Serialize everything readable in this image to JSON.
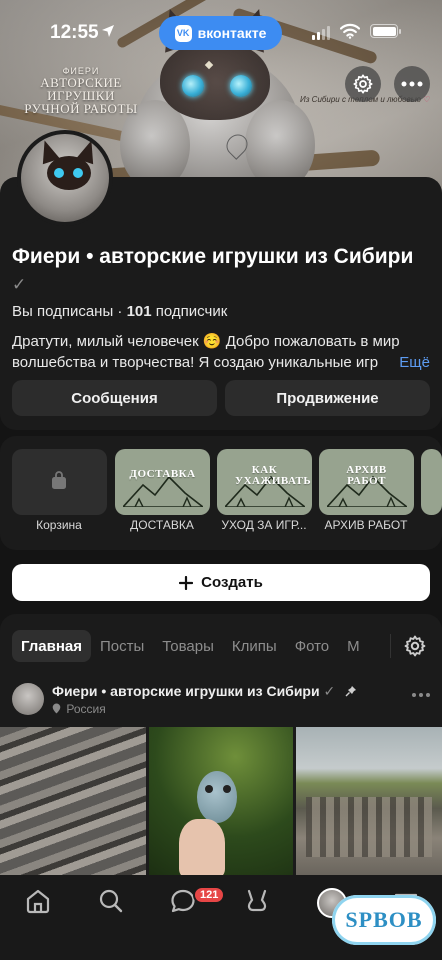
{
  "status_bar": {
    "time": "12:55",
    "app_pill": "вконтакте",
    "app_pill_logo": "VK"
  },
  "cover": {
    "brand_small": "ФИЕРИ",
    "brand_line1": "АВТОРСКИЕ ИГРУШКИ",
    "brand_line2": "РУЧНОЙ РАБОТЫ",
    "tagline": "Из Сибири с теплом и любовью"
  },
  "profile": {
    "name": "Фиери • авторские игрушки из Сибири",
    "verified_mark": "✓",
    "subscription_status": "Вы подписаны",
    "separator": "·",
    "subscriber_count": "101",
    "subscriber_label": "подписчик",
    "description": "Дратути, милый человечек ☺️ Добро пожаловать в мир волшебства и творчества! Я создаю уникальные игр",
    "more_link": "Ещё",
    "buttons": {
      "messages": "Сообщения",
      "promotion": "Продвижение"
    }
  },
  "showcase": {
    "items": [
      {
        "label": "Корзина",
        "cover_text": "",
        "icon": "shopping-bag-icon"
      },
      {
        "label": "ДОСТАВКА",
        "cover_text": "ДОСТАВКА"
      },
      {
        "label": "УХОД ЗА ИГР...",
        "cover_text": "КАК УХАЖИВАТЬ"
      },
      {
        "label": "АРХИВ РАБОТ",
        "cover_text": "АРХИВ РАБОТ"
      }
    ]
  },
  "create_button": {
    "icon": "plus-icon",
    "label": "Создать"
  },
  "tabs": [
    {
      "label": "Главная",
      "active": true
    },
    {
      "label": "Посты",
      "active": false
    },
    {
      "label": "Товары",
      "active": false
    },
    {
      "label": "Клипы",
      "active": false
    },
    {
      "label": "Фото",
      "active": false
    },
    {
      "label": "М",
      "active": false
    }
  ],
  "post": {
    "author": "Фиери • авторские игрушки из Сибири",
    "verified_mark": "✓",
    "location": "Россия",
    "pinned": true
  },
  "bottom_nav": {
    "items": [
      "home-icon",
      "search-icon",
      "messages-icon",
      "clips-icon",
      "profile-avatar",
      "menu-icon"
    ],
    "messages_badge": "121"
  },
  "watermark": "SPBOB",
  "colors": {
    "accent": "#3d8cf2",
    "link": "#5d9cf2",
    "badge": "#e64646",
    "background": "#141414",
    "card": "#1b1b1b",
    "shelf": "#97a38f"
  }
}
